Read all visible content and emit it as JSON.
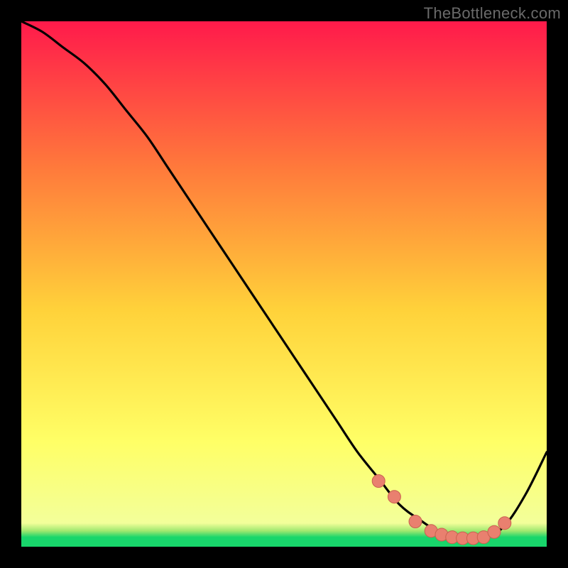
{
  "watermark": "TheBottleneck.com",
  "colors": {
    "page_bg": "#000000",
    "gradient_top": "#ff1a4b",
    "gradient_mid_upper": "#ff7a3b",
    "gradient_mid": "#ffd23a",
    "gradient_lower": "#ffff66",
    "gradient_thin_green": "#18d66b",
    "curve": "#000000",
    "marker_fill": "#e9806f",
    "marker_stroke": "#c9614f"
  },
  "chart_data": {
    "type": "line",
    "title": "",
    "xlabel": "",
    "ylabel": "",
    "xlim": [
      0,
      100
    ],
    "ylim": [
      0,
      100
    ],
    "series": [
      {
        "name": "bottleneck-curve",
        "x": [
          0,
          4,
          8,
          12,
          16,
          20,
          24,
          28,
          32,
          36,
          40,
          44,
          48,
          52,
          56,
          60,
          64,
          68,
          72,
          76,
          80,
          84,
          88,
          92,
          96,
          100
        ],
        "y": [
          100,
          98,
          95,
          92,
          88,
          83,
          78,
          72,
          66,
          60,
          54,
          48,
          42,
          36,
          30,
          24,
          18,
          13,
          8,
          5,
          2.5,
          1.5,
          1.5,
          4,
          10,
          18
        ]
      }
    ],
    "markers": {
      "name": "highlight-points",
      "x": [
        68,
        71,
        75,
        78,
        80,
        82,
        84,
        86,
        88,
        90,
        92
      ],
      "y": [
        12.5,
        9.5,
        4.8,
        3.0,
        2.3,
        1.8,
        1.6,
        1.6,
        1.8,
        2.8,
        4.5
      ]
    }
  }
}
